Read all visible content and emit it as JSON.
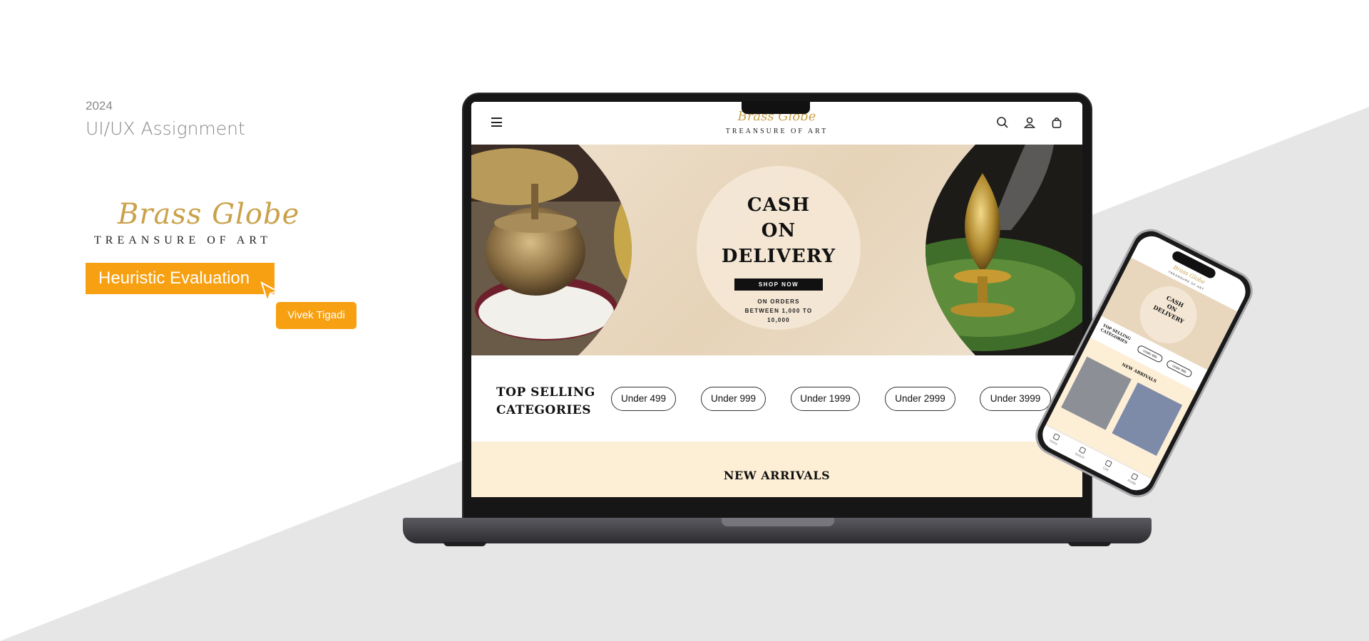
{
  "intro": {
    "year": "2024",
    "subtitle": "UI/UX Assignment",
    "logo_script": "Brass Globe",
    "logo_tagline": "TREANSURE OF ART",
    "badge": "Heuristic Evaluation",
    "author": "Vivek Tigadi",
    "accent_color": "#f7a012"
  },
  "site": {
    "logo_script": "Brass Globe",
    "logo_tagline": "TREANSURE OF ART",
    "icons": [
      "menu-icon",
      "search-icon",
      "user-icon",
      "bag-icon"
    ],
    "hero": {
      "title_line1": "CASH",
      "title_line2": "ON",
      "title_line3": "DELIVERY",
      "cta": "SHOP NOW",
      "note_line1": "ON ORDERS",
      "note_line2": "BETWEEN 1,000 TO",
      "note_line3": "10,000"
    },
    "categories": {
      "title_line1": "TOP SELLING",
      "title_line2": "CATEGORIES",
      "pills": [
        "Under 499",
        "Under 999",
        "Under 1999",
        "Under 2999",
        "Under 3999"
      ]
    },
    "new_arrivals": "NEW ARRIVALS"
  },
  "phone": {
    "logo_script": "Brass Globe",
    "logo_tagline": "TREANSURE OF ART",
    "hero_title_line1": "CASH",
    "hero_title_line2": "ON",
    "hero_title_line3": "DELIVERY",
    "cat_line1": "TOP SELLING",
    "cat_line2": "CATEGORIES",
    "pills": [
      "Under 499",
      "Under 999"
    ],
    "new_arrivals": "NEW ARRIVALS",
    "nav": [
      "Home",
      "Search",
      "Cart",
      "Profile"
    ]
  }
}
